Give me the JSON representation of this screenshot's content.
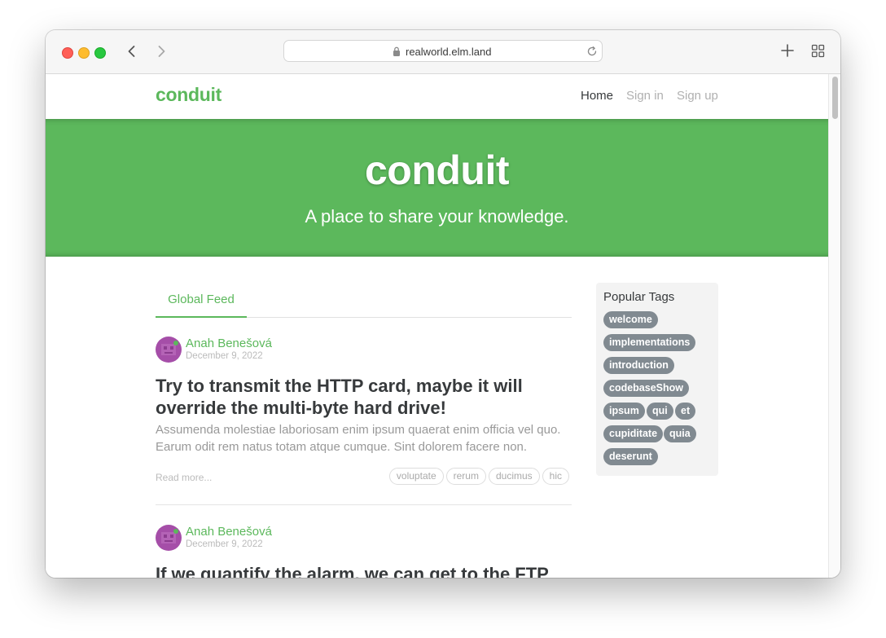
{
  "browser": {
    "url": "realworld.elm.land"
  },
  "nav": {
    "brand": "conduit",
    "links": [
      "Home",
      "Sign in",
      "Sign up"
    ]
  },
  "banner": {
    "title": "conduit",
    "subtitle": "A place to share your knowledge."
  },
  "feed": {
    "tab": "Global Feed",
    "articles": [
      {
        "author": "Anah Benešová",
        "date": "December 9, 2022",
        "title": "Try to transmit the HTTP card, maybe it will override the multi-byte hard drive!",
        "description": "Assumenda molestiae laboriosam enim ipsum quaerat enim officia vel quo. Earum odit rem natus totam atque cumque. Sint dolorem facere non.",
        "read_more": "Read more...",
        "tags": [
          "voluptate",
          "rerum",
          "ducimus",
          "hic"
        ]
      },
      {
        "author": "Anah Benešová",
        "date": "December 9, 2022",
        "title": "If we quantify the alarm, we can get to the FTP"
      }
    ]
  },
  "sidebar": {
    "title": "Popular Tags",
    "tags": [
      "welcome",
      "implementations",
      "introduction",
      "codebaseShow",
      "ipsum",
      "qui",
      "et",
      "cupiditate",
      "quia",
      "deserunt"
    ]
  },
  "colors": {
    "brand_green": "#5cb85c",
    "tag_gray": "#818a91"
  }
}
